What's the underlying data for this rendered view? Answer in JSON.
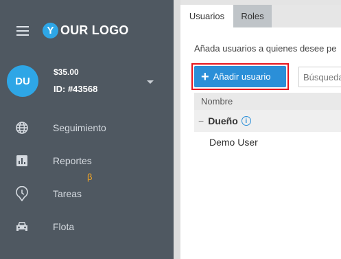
{
  "brand": {
    "logo_letter": "Y",
    "logo_text": "OUR LOGO"
  },
  "account": {
    "initials": "DU",
    "balance": "$35.00",
    "id": "ID: #43568"
  },
  "nav": {
    "items": [
      {
        "label": "Seguimiento",
        "icon": "globe-icon"
      },
      {
        "label": "Reportes",
        "icon": "bar-chart-icon"
      },
      {
        "label": "Tareas",
        "icon": "clock-pin-icon",
        "badge": "β"
      },
      {
        "label": "Flota",
        "icon": "car-icon"
      }
    ]
  },
  "tabs": [
    {
      "label": "Usuarios",
      "active": true
    },
    {
      "label": "Roles",
      "active": false
    }
  ],
  "main": {
    "instruction": "Añada usuarios a quienes desee pe",
    "add_button_label": "Añadir usuario",
    "search_placeholder": "Búsqueda",
    "column_header": "Nombre",
    "group": {
      "label": "Dueño",
      "collapse_symbol": "−"
    },
    "users": [
      "Demo User"
    ]
  },
  "colors": {
    "sidebar": "#4f5861",
    "accent": "#2ea6e6",
    "button": "#2b8fd8",
    "highlight": "#e8141c",
    "beta": "#f5a623"
  }
}
